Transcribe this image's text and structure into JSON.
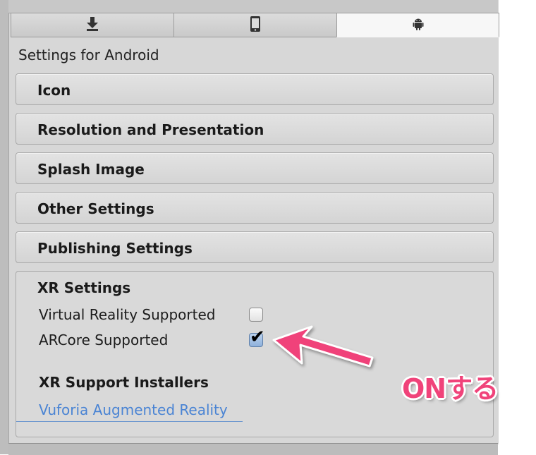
{
  "tabs": [
    {
      "icon": "download-icon",
      "active": false
    },
    {
      "icon": "mobile-phone-icon",
      "active": false
    },
    {
      "icon": "android-icon",
      "active": true
    }
  ],
  "settings_title": "Settings for Android",
  "sections": [
    {
      "label": "Icon"
    },
    {
      "label": "Resolution and Presentation"
    },
    {
      "label": "Splash Image"
    },
    {
      "label": "Other Settings"
    },
    {
      "label": "Publishing Settings"
    }
  ],
  "xr": {
    "title": "XR Settings",
    "virtual_reality_label": "Virtual Reality Supported",
    "virtual_reality_checked": false,
    "arcore_label": "ARCore Supported",
    "arcore_checked": true,
    "installers_title": "XR Support Installers",
    "vuforia_link": "Vuforia Augmented Reality"
  },
  "annotation": {
    "text": "ONする",
    "color": "#f0437a"
  }
}
